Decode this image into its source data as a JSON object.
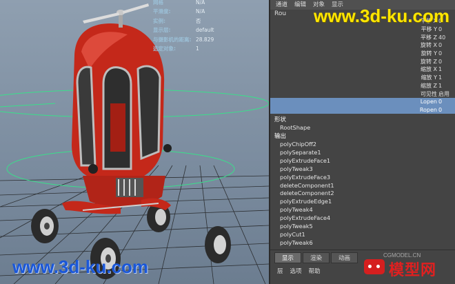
{
  "hud": {
    "rows": [
      {
        "label": "网格",
        "value": "N/A"
      },
      {
        "label": "平滑度:",
        "value": "N/A"
      },
      {
        "label": "实例:",
        "value": "否"
      },
      {
        "label": "显示层:",
        "value": "default"
      },
      {
        "label": "与摄影机的距离:",
        "value": "28.829"
      },
      {
        "label": "选定对象:",
        "value": "1"
      }
    ]
  },
  "watermark": {
    "top": "www.3d-ku.com",
    "bottom": "www.3d-ku.com"
  },
  "channel_box": {
    "menu": [
      "通道",
      "编辑",
      "对象",
      "显示"
    ],
    "object_name": "Rou",
    "attributes": [
      {
        "name": "平移 X",
        "value": "0"
      },
      {
        "name": "平移 Y",
        "value": "0"
      },
      {
        "name": "平移 Z",
        "value": "40"
      },
      {
        "name": "旋转 X",
        "value": "0"
      },
      {
        "name": "旋转 Y",
        "value": "0"
      },
      {
        "name": "旋转 Z",
        "value": "0"
      },
      {
        "name": "缩放 X",
        "value": "1"
      },
      {
        "name": "缩放 Y",
        "value": "1"
      },
      {
        "name": "缩放 Z",
        "value": "1"
      },
      {
        "name": "可见性",
        "value": "启用"
      },
      {
        "name": "Lopen",
        "value": "0",
        "highlighted": true
      },
      {
        "name": "Ropen",
        "value": "0",
        "highlighted": true
      }
    ],
    "shape_title": "形状",
    "shape_node": "RootShape",
    "inputs_title": "输出",
    "input_nodes": [
      "polyChipOff2",
      "polySeparate1",
      "polyExtrudeFace1",
      "polyTweak3",
      "polyExtrudeFace3",
      "deleteComponent1",
      "deleteComponent2",
      "polyExtrudeEdge1",
      "polyTweak4",
      "polyExtrudeFace4",
      "polyTweak5",
      "polyCut1",
      "polyTweak6"
    ]
  },
  "layer_editor": {
    "tabs": [
      "显示",
      "渲染",
      "动画"
    ],
    "menus": [
      "层",
      "选项",
      "帮助"
    ]
  },
  "logo": {
    "small": "CGMODEL.CN",
    "big": "模型网"
  },
  "colors": {
    "highlight": "#6b8fbd",
    "vehicle_red": "#c4281a",
    "watermark_yellow": "#ffe600",
    "watermark_blue": "#1a57d8"
  }
}
